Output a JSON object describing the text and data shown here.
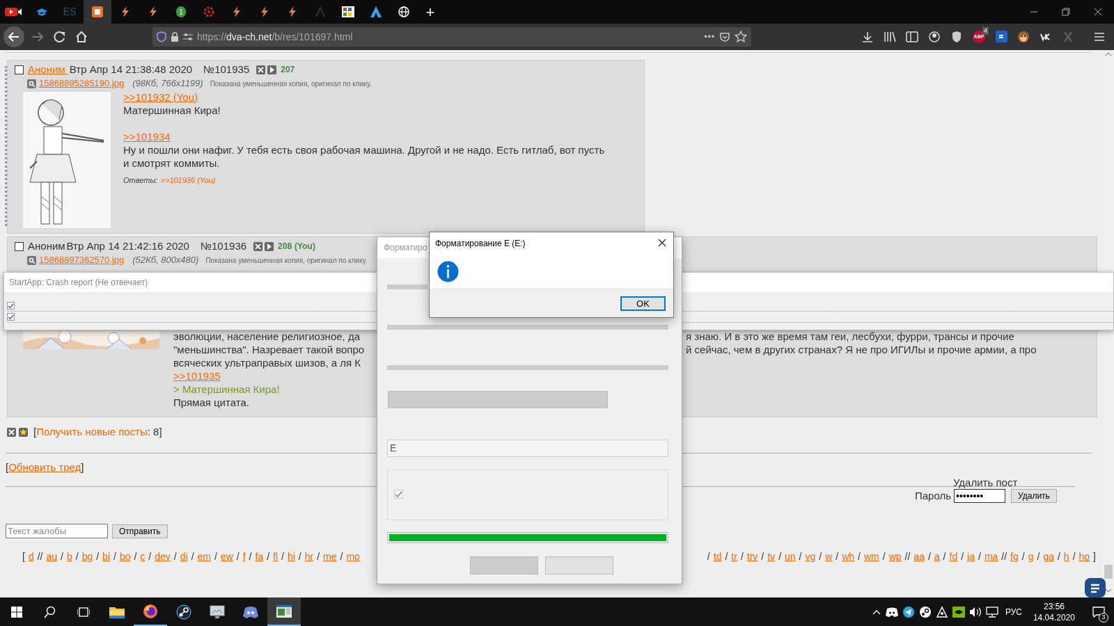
{
  "browser": {
    "tabs": [
      {
        "selected": false
      },
      {
        "selected": false
      },
      {
        "text": "ES",
        "selected": false
      },
      {
        "selected": true
      },
      {
        "selected": false
      },
      {
        "selected": false
      },
      {
        "text": "1",
        "selected": false
      },
      {
        "selected": false
      },
      {
        "selected": false
      },
      {
        "selected": false
      },
      {
        "selected": false
      },
      {
        "selected": false
      },
      {
        "selected": false
      },
      {
        "selected": false
      },
      {
        "selected": false
      }
    ],
    "new_tab": "+",
    "url_prefix": "https://",
    "url_host": "dva-ch.net",
    "url_path": "/b/res/101697.html",
    "url_menu": "•••",
    "adblock": {
      "text": "ABP",
      "badge": "4"
    }
  },
  "posts": [
    {
      "checked": false,
      "name": "Аноним ",
      "name_link": true,
      "date": "Втр Апр 14 21:38:48 2020",
      "number": "№101935",
      "count": "207",
      "file": "15868895285190.jpg",
      "file_meta": "(98Кб, 766x1199)",
      "file_note": "Показана уменьшенная копия, оригинал по клику.",
      "body": [
        {
          "kind": "link",
          "text": ">>101932 (You)"
        },
        {
          "kind": "text",
          "text": "Матершинная Кира!"
        },
        {
          "kind": "gap"
        },
        {
          "kind": "link",
          "text": ">>101934"
        },
        {
          "kind": "text",
          "text": "Ну и пошли они нафиг. У тебя есть своя рабочая машина. Другой и не надо. Есть гитлаб, вот пусть и смотрят коммиты."
        }
      ],
      "replies_label": "Ответы:",
      "replies": [
        ">>101936 (You)"
      ]
    },
    {
      "checked": false,
      "name": "Аноним",
      "name_link": false,
      "date": "Втр Апр 14 21:42:16 2020",
      "number": "№101936",
      "count": "208",
      "you": "(You)",
      "file": "15868897362570.jpg",
      "file_meta": "(52Кб, 800x480)",
      "file_note": "Показана уменьшенная копия, оригинал по клику.",
      "body": [
        {
          "kind": "gap"
        },
        {
          "kind": "split",
          "left": "эволюции, население религиозное, да",
          "right": "я знаю. И в это же время там геи, лесбухи, фурри, трансы и прочие"
        },
        {
          "kind": "split",
          "left": "\"меньшинства\". Назревает такой вопро",
          "right": "й сейчас, чем в других странах? Я не про ИГИЛы и прочие армии, а про"
        },
        {
          "kind": "split",
          "left": "всяческих ультраправых шизов, а ля К"
        },
        {
          "kind": "link",
          "text": ">>101935"
        },
        {
          "kind": "quote",
          "text": "> Матершинная Кира!"
        },
        {
          "kind": "text",
          "text": "Прямая цитата."
        }
      ]
    }
  ],
  "thread_footer": {
    "new_posts_link": "Получить новые посты",
    "new_posts_count": ": 8",
    "open": "[",
    "close": "]",
    "refresh_link": "Обновить тред",
    "delete_title": "Удалить пост",
    "password_label": "Пароль",
    "password_value": "••••••••",
    "delete_button": "Удалить",
    "report_placeholder": "Текст жалобы",
    "report_button": "Отправить"
  },
  "board_links": {
    "left": [
      {
        "before": "[",
        "text": "d"
      },
      {
        "before": "//",
        "text": "au"
      },
      {
        "before": "/",
        "text": "b"
      },
      {
        "before": "/",
        "text": "bg"
      },
      {
        "before": "/",
        "text": "bi"
      },
      {
        "before": "/",
        "text": "bo"
      },
      {
        "before": "/",
        "text": "c"
      },
      {
        "before": "/",
        "text": "dev"
      },
      {
        "before": "/",
        "text": "di"
      },
      {
        "before": "/",
        "text": "em"
      },
      {
        "before": "/",
        "text": "ew"
      },
      {
        "before": "/",
        "text": "f"
      },
      {
        "before": "/",
        "text": "fa"
      },
      {
        "before": "/",
        "text": "fl"
      },
      {
        "before": "/",
        "text": "hi"
      },
      {
        "before": "/",
        "text": "hr"
      },
      {
        "before": "/",
        "text": "me"
      },
      {
        "before": "/",
        "text": "mo"
      }
    ],
    "right": [
      {
        "before": "/",
        "text": "td"
      },
      {
        "before": "/",
        "text": "tr"
      },
      {
        "before": "/",
        "text": "trv"
      },
      {
        "before": "/",
        "text": "tv"
      },
      {
        "before": "/",
        "text": "un"
      },
      {
        "before": "/",
        "text": "vg"
      },
      {
        "before": "/",
        "text": "w"
      },
      {
        "before": "/",
        "text": "wh"
      },
      {
        "before": "/",
        "text": "wm"
      },
      {
        "before": "/",
        "text": "wp"
      },
      {
        "before": "//",
        "text": "aa"
      },
      {
        "before": "/",
        "text": "a"
      },
      {
        "before": "/",
        "text": "fd"
      },
      {
        "before": "/",
        "text": "ja"
      },
      {
        "before": "/",
        "text": "ma"
      },
      {
        "before": "//",
        "text": "fg"
      },
      {
        "before": "/",
        "text": "g"
      },
      {
        "before": "/",
        "text": "ga"
      },
      {
        "before": "/",
        "text": "h"
      },
      {
        "before": "/",
        "text": "ho"
      }
    ],
    "end": "]"
  },
  "crash_window": {
    "title": "StartApp: Crash report (Не отвечает)",
    "rows": [
      {
        "checked": true
      },
      {
        "checked": true
      }
    ]
  },
  "format_dialog": {
    "title": "Форматиро",
    "field_value": "E",
    "checkbox": {
      "checked": true,
      "disabled": true
    },
    "progress": {
      "level": 1
    }
  },
  "message_box": {
    "title": "Форматирование E (E:)",
    "button": "OK"
  },
  "taskbar": {
    "apps": [
      {
        "running": false,
        "selected": false
      },
      {
        "running": false,
        "selected": false
      },
      {
        "running": false,
        "selected": false
      },
      {
        "running": false,
        "selected": false
      },
      {
        "running": true,
        "selected": false
      },
      {
        "running": false,
        "selected": false
      },
      {
        "running": false,
        "selected": false
      },
      {
        "running": false,
        "selected": false
      },
      {
        "running": true,
        "selected": true
      }
    ],
    "language": "РУС",
    "time": "23:56",
    "date": "14.04.2020",
    "notifications": "3"
  }
}
